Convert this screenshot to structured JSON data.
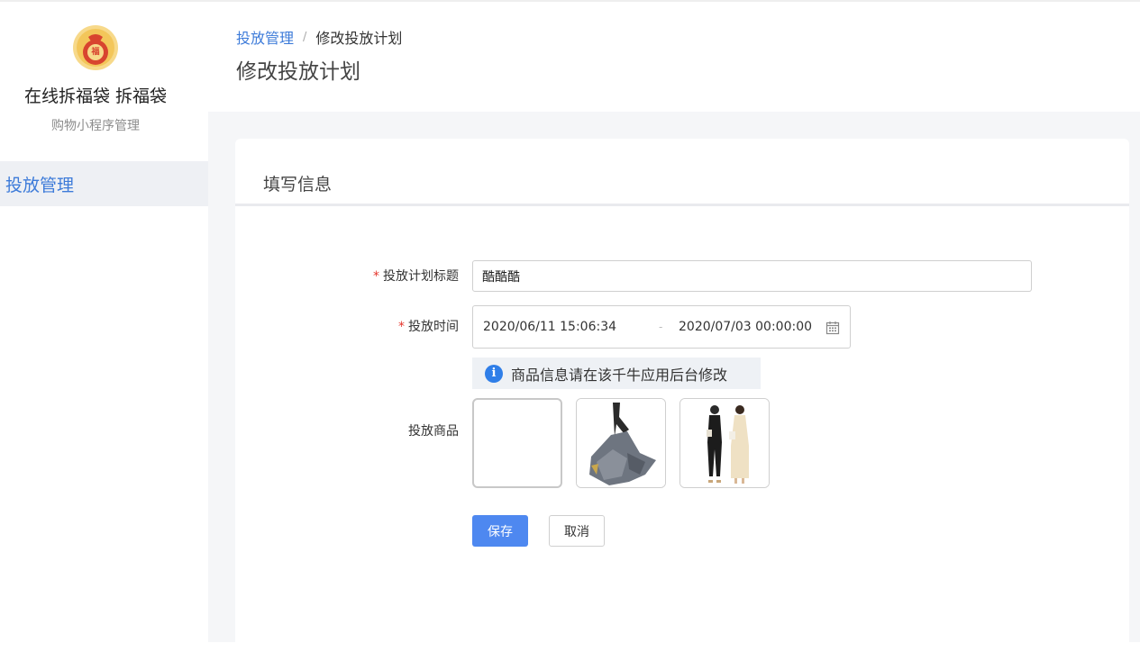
{
  "sidebar": {
    "logo_char": "福",
    "app_name": "在线拆福袋 拆福袋",
    "app_subtitle": "购物小程序管理",
    "menu": [
      {
        "label": "投放管理",
        "active": true
      }
    ]
  },
  "header": {
    "breadcrumb": {
      "parent": "投放管理",
      "separator": "/",
      "current": "修改投放计划"
    },
    "title": "修改投放计划"
  },
  "form": {
    "card_title": "填写信息",
    "plan_title": {
      "label": "投放计划标题",
      "required": true,
      "value": "酷酷酷"
    },
    "schedule": {
      "label": "投放时间",
      "required": true,
      "start": "2020/06/11 15:06:34",
      "separator": "-",
      "end": "2020/07/03 00:00:00"
    },
    "notice": "商品信息请在该千牛应用后台修改",
    "products": {
      "label": "投放商品",
      "items": [
        {
          "type": "empty"
        },
        {
          "type": "image",
          "icon": "skirt-product-image"
        },
        {
          "type": "image",
          "icon": "dresses-product-image"
        }
      ]
    },
    "save_label": "保存",
    "cancel_label": "取消"
  },
  "colors": {
    "accent": "#3d7bd9",
    "primary_button": "#4e88f0",
    "required": "#e5352c",
    "info": "#2f7ee8"
  }
}
